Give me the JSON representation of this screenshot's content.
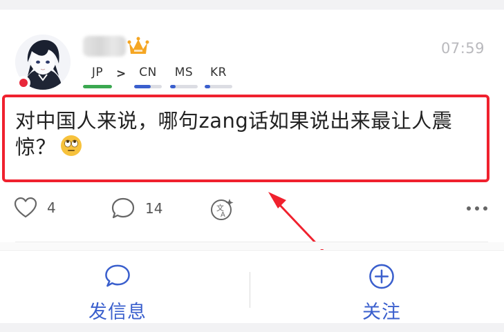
{
  "post": {
    "timestamp": "07:59",
    "text": "对中国人来说，哪句zang话如果说出来最让人震惊？",
    "emoji": "rolling-eyes-emoji"
  },
  "languages": {
    "native": {
      "code": "JP",
      "level": 1.0,
      "color": "#3aa850"
    },
    "arrow": ">",
    "learning": [
      {
        "code": "CN",
        "level": 0.6,
        "color": "#3a5fcd"
      },
      {
        "code": "MS",
        "level": 0.2,
        "color": "#3a5fcd"
      },
      {
        "code": "KR",
        "level": 0.2,
        "color": "#3a5fcd"
      }
    ]
  },
  "actions": {
    "likes": "4",
    "comments": "14"
  },
  "bottom_bar": {
    "message_label": "发信息",
    "follow_label": "关注"
  },
  "colors": {
    "accent": "#3a5fcd",
    "highlight_border": "#f0212e",
    "online": "#e8283a",
    "crown": "#f5a623"
  }
}
